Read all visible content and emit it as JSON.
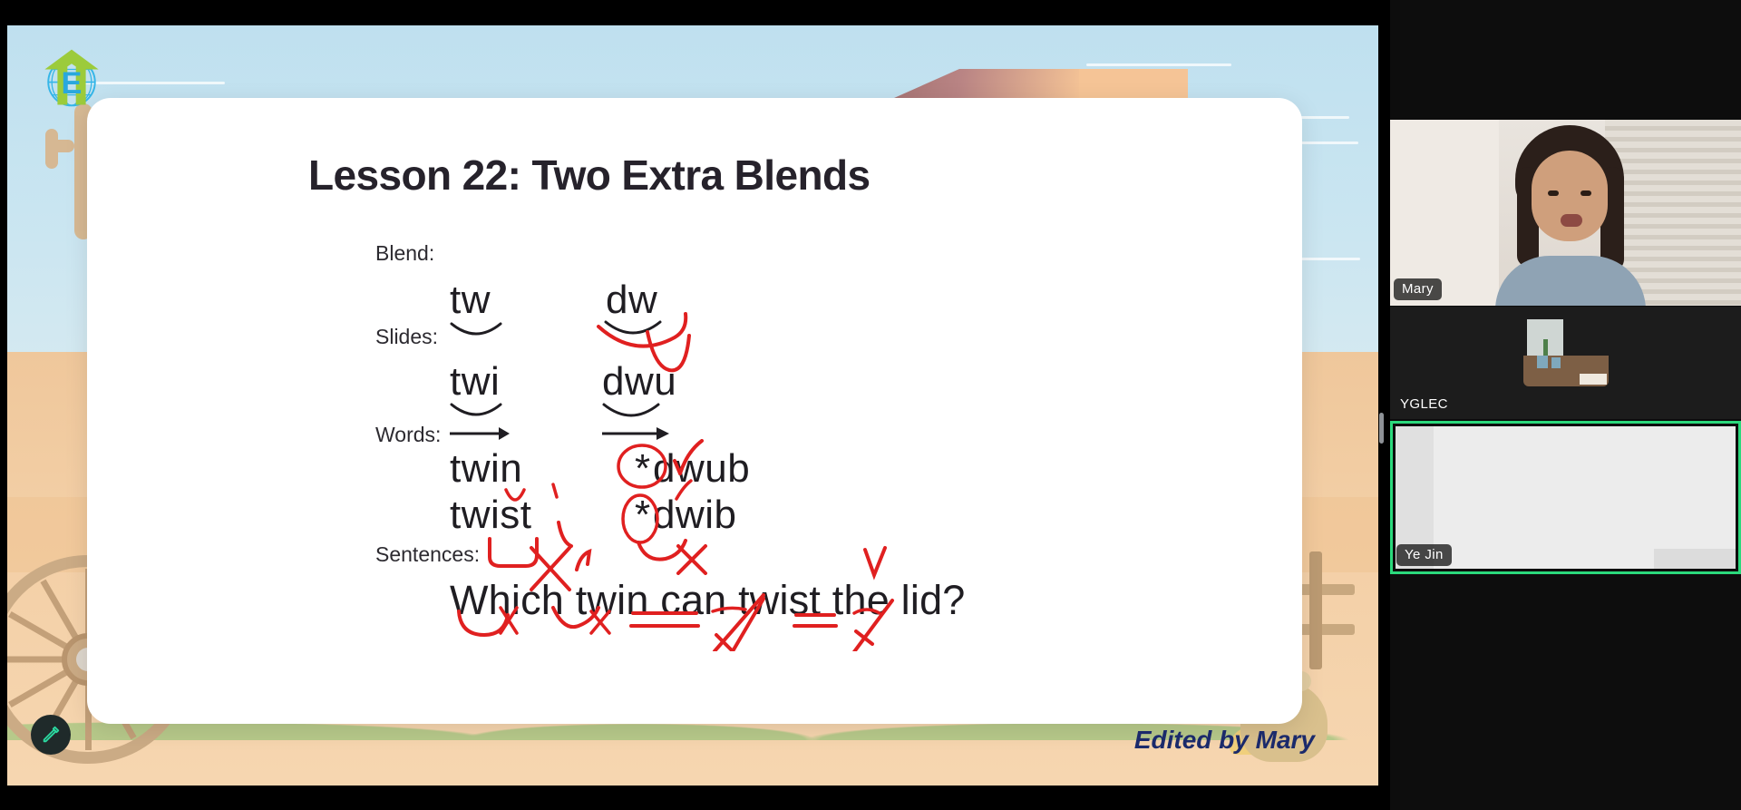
{
  "meeting": {
    "layout": "shared-screen-with-speaker-strip",
    "accent_active_speaker": "#2bd97c",
    "annotate_button": {
      "name": "annotate-pencil",
      "icon": "pencil-icon"
    },
    "divider_handle": "drag-to-resize"
  },
  "share": {
    "background_theme": "western-desert-cartoon",
    "logo": {
      "icon": "globe-arrow-logo",
      "letter": "E"
    },
    "watermark": "Edited by Mary",
    "slide": {
      "title": "Lesson 22: Two Extra Blends",
      "rows": [
        {
          "label": "Blend:",
          "items": [
            {
              "text": "tw",
              "marks": [
                "arc-under"
              ]
            },
            {
              "text": "dw",
              "marks": [
                "arc-under",
                "red-arc-under",
                "red-check"
              ]
            }
          ]
        },
        {
          "label": "Slides:",
          "items": [
            {
              "text": "twi",
              "marks": [
                "arc-under",
                "arrow-under"
              ]
            },
            {
              "text": "dwu",
              "marks": [
                "arc-under",
                "arrow-under",
                "red-check"
              ]
            }
          ]
        },
        {
          "label": "Words:",
          "items": [
            {
              "text": "twin",
              "marks": [
                "red-check",
                "red-tick"
              ]
            },
            {
              "text": "twist",
              "marks": [
                "red-underline-u",
                "red-x",
                "red-tick"
              ]
            },
            {
              "text": "dwub",
              "marks": [
                "red-circle-asterisk",
                "red-check"
              ]
            },
            {
              "text": "dwib",
              "marks": [
                "red-circle-asterisk",
                "red-arc",
                "red-x"
              ]
            }
          ]
        },
        {
          "label": "Sentences:",
          "items": [
            {
              "text": "Which twin can twist the lid?",
              "marks": [
                "red-scoops",
                "red-x",
                "double-underline-can",
                "red-check",
                "red-slash"
              ]
            }
          ]
        }
      ],
      "asterisk_glyph": "*"
    }
  },
  "participants": [
    {
      "name": "Mary",
      "kind": "video",
      "active_speaker": false
    },
    {
      "name": "YGLEC",
      "kind": "photo-avatar",
      "active_speaker": false
    },
    {
      "name": "Ye Jin",
      "kind": "screen-share",
      "active_speaker": true
    }
  ]
}
